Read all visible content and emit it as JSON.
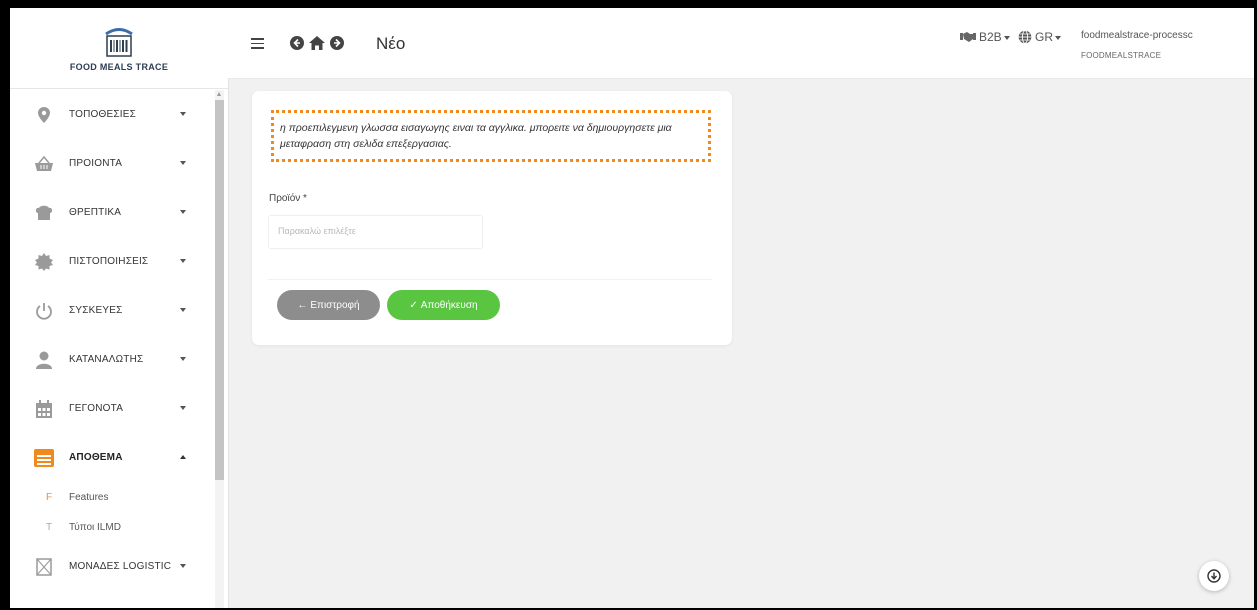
{
  "brand": {
    "name": "FOOD MEALS TRACE"
  },
  "sidebar": {
    "items": [
      {
        "label": "ΤΟΠΟΘΕΣΙΕΣ",
        "icon": "map-pin-icon"
      },
      {
        "label": "ΠΡΟΙΟΝΤΑ",
        "icon": "basket-icon"
      },
      {
        "label": "ΘΡΕΠΤΙΚΑ",
        "icon": "chef-hat-icon"
      },
      {
        "label": "ΠΙΣΤΟΠΟΙΗΣΕΙΣ",
        "icon": "certificate-badge-icon"
      },
      {
        "label": "ΣΥΣΚΕΥΕΣ",
        "icon": "power-icon"
      },
      {
        "label": "ΚΑΤΑΝΑΛΩΤΗΣ",
        "icon": "user-icon"
      },
      {
        "label": "ΓΕΓΟΝΟΤΑ",
        "icon": "calendar-icon"
      },
      {
        "label": "ΑΠΟΘΕΜΑ",
        "icon": "warehouse-icon",
        "active": true,
        "accent": "#f08a1e"
      },
      {
        "label": "ΜΟΝΑΔΕΣ LOGISTIC",
        "icon": "box-icon"
      }
    ],
    "subitems": [
      {
        "letter": "F",
        "label": "Features"
      },
      {
        "letter": "T",
        "label": "Τύποι ILMD"
      }
    ]
  },
  "header": {
    "title": "Νέο",
    "b2b_label": "B2B",
    "lang_label": "GR",
    "user_name": "foodmealstrace-processc",
    "user_org": "FOODMEALSTRACE"
  },
  "form": {
    "notice": "η προεπιλεγμενη γλωσσα εισαγωγης ειναι τα αγγλικα. μπορειτε να δημιουργησετε μια μεταφραση στη σελιδα επεξεργασιας.",
    "product_label": "Προϊόν *",
    "product_placeholder": "Παρακαλώ επιλέξτε",
    "back_label": "Επιστροφή",
    "save_label": "Αποθήκευση"
  },
  "colors": {
    "accent_orange": "#f08a1e",
    "save_green": "#5ac541",
    "back_gray": "#8d8d8d"
  }
}
